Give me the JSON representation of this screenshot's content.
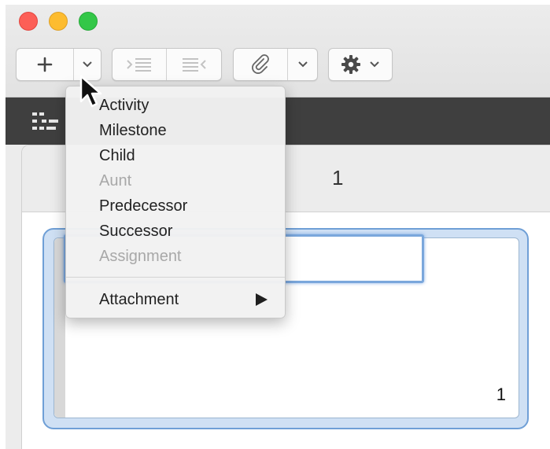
{
  "toolbar": {
    "add_icon": "plus-icon",
    "add_menu_icon": "chevron-down-icon",
    "indent_icon": "indent-icon",
    "outdent_icon": "outdent-icon",
    "attach_icon": "paperclip-icon",
    "attach_menu_icon": "chevron-down-icon",
    "settings_icon": "gear-icon",
    "settings_menu_icon": "chevron-down-icon"
  },
  "view_bar": {
    "view_icon": "outline-view-icon"
  },
  "pane": {
    "header_number": "1",
    "card_number": "1",
    "text_field_value": ""
  },
  "add_menu": {
    "items": [
      {
        "label": "Activity",
        "enabled": true
      },
      {
        "label": "Milestone",
        "enabled": true
      },
      {
        "label": "Child",
        "enabled": true
      },
      {
        "label": "Aunt",
        "enabled": false
      },
      {
        "label": "Predecessor",
        "enabled": true
      },
      {
        "label": "Successor",
        "enabled": true
      },
      {
        "label": "Assignment",
        "enabled": false
      }
    ],
    "submenu_item": {
      "label": "Attachment",
      "has_submenu": true
    }
  },
  "colors": {
    "close": "#fc5f57",
    "minimize": "#fdbc2f",
    "zoom": "#33c748",
    "focus_accent": "#6f9fd6",
    "dark_bar": "#3f3f3f"
  }
}
